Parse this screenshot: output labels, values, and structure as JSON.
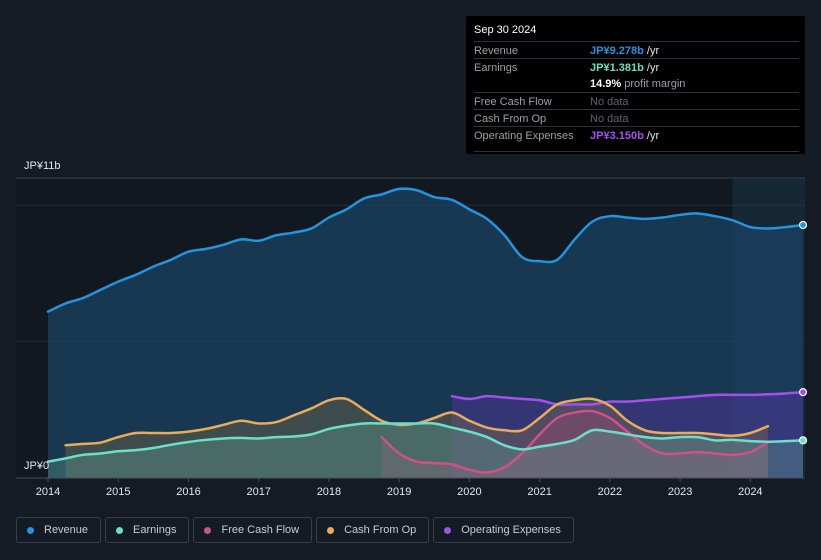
{
  "tooltip": {
    "date": "Sep 30 2024",
    "rows": [
      {
        "label": "Revenue",
        "value": "JP¥9.278b",
        "unit": " /yr",
        "color": "#2394df"
      },
      {
        "label": "Earnings",
        "value": "JP¥1.381b",
        "unit": " /yr",
        "color": "#6ae0c8"
      },
      {
        "label": "",
        "value": "14.9%",
        "unit": " profit margin",
        "color": "#ffffff"
      },
      {
        "label": "Free Cash Flow",
        "value": "",
        "unit": "No data",
        "color": "#7c8086"
      },
      {
        "label": "Cash From Op",
        "value": "",
        "unit": "No data",
        "color": "#7c8086"
      },
      {
        "label": "Operating Expenses",
        "value": "JP¥3.150b",
        "unit": " /yr",
        "color": "#a64ff0"
      }
    ]
  },
  "legend": [
    {
      "label": "Revenue",
      "color": "#2394df"
    },
    {
      "label": "Earnings",
      "color": "#6ae0c8"
    },
    {
      "label": "Free Cash Flow",
      "color": "#d0508a"
    },
    {
      "label": "Cash From Op",
      "color": "#e8ac5a"
    },
    {
      "label": "Operating Expenses",
      "color": "#a64ff0"
    }
  ],
  "chart_data": {
    "type": "area",
    "title": "",
    "xlabel": "",
    "ylabel": "",
    "y_top_label": "JP¥11b",
    "y_bottom_label": "JP¥0",
    "ylim": [
      0,
      11
    ],
    "xlim": [
      2014.0,
      2024.75
    ],
    "x_ticks": [
      "2014",
      "2015",
      "2016",
      "2017",
      "2018",
      "2019",
      "2020",
      "2021",
      "2022",
      "2023",
      "2024"
    ],
    "forecast_shade_start": 2023.75,
    "series": [
      {
        "name": "Revenue",
        "color": "#2394df",
        "end_marker": true,
        "x": [
          2014.0,
          2014.25,
          2014.5,
          2014.75,
          2015.0,
          2015.25,
          2015.5,
          2015.75,
          2016.0,
          2016.25,
          2016.5,
          2016.75,
          2017.0,
          2017.25,
          2017.5,
          2017.75,
          2018.0,
          2018.25,
          2018.5,
          2018.75,
          2019.0,
          2019.25,
          2019.5,
          2019.75,
          2020.0,
          2020.25,
          2020.5,
          2020.75,
          2021.0,
          2021.25,
          2021.5,
          2021.75,
          2022.0,
          2022.25,
          2022.5,
          2022.75,
          2023.0,
          2023.25,
          2023.5,
          2023.75,
          2024.0,
          2024.25,
          2024.5,
          2024.75
        ],
        "y": [
          6.1,
          6.4,
          6.6,
          6.9,
          7.2,
          7.45,
          7.75,
          8.0,
          8.3,
          8.4,
          8.55,
          8.75,
          8.7,
          8.9,
          9.0,
          9.15,
          9.55,
          9.85,
          10.25,
          10.4,
          10.6,
          10.55,
          10.3,
          10.2,
          9.85,
          9.5,
          8.9,
          8.1,
          7.95,
          8.0,
          8.75,
          9.4,
          9.6,
          9.55,
          9.5,
          9.55,
          9.65,
          9.7,
          9.6,
          9.45,
          9.2,
          9.15,
          9.2,
          9.278
        ]
      },
      {
        "name": "Earnings",
        "color": "#6ae0c8",
        "end_marker": true,
        "x": [
          2014.0,
          2014.25,
          2014.5,
          2014.75,
          2015.0,
          2015.25,
          2015.5,
          2015.75,
          2016.0,
          2016.25,
          2016.5,
          2016.75,
          2017.0,
          2017.25,
          2017.5,
          2017.75,
          2018.0,
          2018.25,
          2018.5,
          2018.75,
          2019.0,
          2019.25,
          2019.5,
          2019.75,
          2020.0,
          2020.25,
          2020.5,
          2020.75,
          2021.0,
          2021.25,
          2021.5,
          2021.75,
          2022.0,
          2022.25,
          2022.5,
          2022.75,
          2023.0,
          2023.25,
          2023.5,
          2023.75,
          2024.0,
          2024.25,
          2024.5,
          2024.75
        ],
        "y": [
          0.6,
          0.72,
          0.85,
          0.9,
          0.98,
          1.02,
          1.1,
          1.22,
          1.32,
          1.4,
          1.45,
          1.47,
          1.45,
          1.5,
          1.52,
          1.6,
          1.8,
          1.92,
          2.0,
          2.0,
          2.0,
          2.0,
          2.0,
          1.85,
          1.7,
          1.5,
          1.2,
          1.05,
          1.15,
          1.25,
          1.4,
          1.75,
          1.7,
          1.6,
          1.5,
          1.45,
          1.5,
          1.5,
          1.38,
          1.4,
          1.35,
          1.33,
          1.35,
          1.381
        ]
      },
      {
        "name": "Free Cash Flow",
        "color": "#d0508a",
        "end_marker": false,
        "x": [
          2018.75,
          2019.0,
          2019.25,
          2019.5,
          2019.75,
          2020.0,
          2020.25,
          2020.5,
          2020.75,
          2021.0,
          2021.25,
          2021.5,
          2021.75,
          2022.0,
          2022.25,
          2022.5,
          2022.75,
          2023.0,
          2023.25,
          2023.5,
          2023.75,
          2024.0,
          2024.25
        ],
        "y": [
          1.5,
          0.9,
          0.6,
          0.55,
          0.5,
          0.3,
          0.2,
          0.4,
          0.9,
          1.6,
          2.2,
          2.4,
          2.45,
          2.2,
          1.7,
          1.2,
          0.9,
          0.9,
          0.95,
          0.9,
          0.85,
          0.95,
          1.3
        ]
      },
      {
        "name": "Cash From Op",
        "color": "#e8ac5a",
        "end_marker": false,
        "x": [
          2014.25,
          2014.5,
          2014.75,
          2015.0,
          2015.25,
          2015.5,
          2015.75,
          2016.0,
          2016.25,
          2016.5,
          2016.75,
          2017.0,
          2017.25,
          2017.5,
          2017.75,
          2018.0,
          2018.25,
          2018.5,
          2018.75,
          2019.0,
          2019.25,
          2019.5,
          2019.75,
          2020.0,
          2020.25,
          2020.5,
          2020.75,
          2021.0,
          2021.25,
          2021.5,
          2021.75,
          2022.0,
          2022.25,
          2022.5,
          2022.75,
          2023.0,
          2023.25,
          2023.5,
          2023.75,
          2024.0,
          2024.25
        ],
        "y": [
          1.2,
          1.25,
          1.3,
          1.5,
          1.65,
          1.65,
          1.65,
          1.7,
          1.8,
          1.95,
          2.1,
          2.0,
          2.05,
          2.3,
          2.55,
          2.85,
          2.9,
          2.5,
          2.1,
          1.95,
          2.0,
          2.2,
          2.4,
          2.1,
          1.85,
          1.75,
          1.75,
          2.2,
          2.7,
          2.85,
          2.9,
          2.65,
          2.1,
          1.75,
          1.65,
          1.65,
          1.65,
          1.6,
          1.55,
          1.65,
          1.9
        ]
      },
      {
        "name": "Operating Expenses",
        "color": "#a64ff0",
        "end_marker": true,
        "x": [
          2019.75,
          2020.0,
          2020.25,
          2020.5,
          2020.75,
          2021.0,
          2021.25,
          2021.5,
          2021.75,
          2022.0,
          2022.25,
          2022.5,
          2022.75,
          2023.0,
          2023.25,
          2023.5,
          2023.75,
          2024.0,
          2024.25,
          2024.5,
          2024.75
        ],
        "y": [
          3.0,
          2.9,
          3.0,
          2.95,
          2.9,
          2.85,
          2.7,
          2.7,
          2.7,
          2.8,
          2.8,
          2.85,
          2.9,
          2.95,
          3.0,
          3.05,
          3.05,
          3.05,
          3.07,
          3.1,
          3.15
        ]
      }
    ]
  }
}
